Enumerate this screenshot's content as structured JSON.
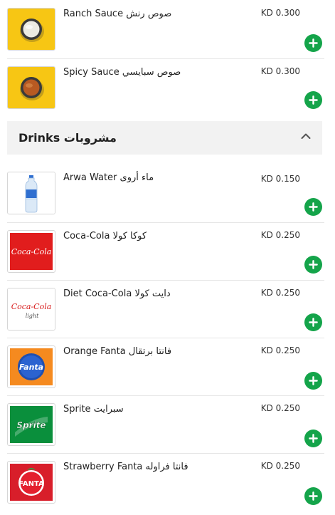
{
  "items_top": [
    {
      "name": "Ranch Sauce صوص رنش",
      "price": "KD 0.300",
      "icon": "ranch-sauce-icon"
    },
    {
      "name": "Spicy Sauce صوص سبايسي",
      "price": "KD 0.300",
      "icon": "spicy-sauce-icon"
    }
  ],
  "section": {
    "title": "Drinks مشروبات",
    "icon": "chevron-up-icon"
  },
  "drinks": [
    {
      "name": "Arwa Water ماء أروى",
      "price": "KD 0.150",
      "icon": "water-bottle-icon"
    },
    {
      "name": "Coca-Cola كوكا كولا",
      "price": "KD 0.250",
      "icon": "coca-cola-logo"
    },
    {
      "name": "Diet Coca-Cola دايت كولا",
      "price": "KD 0.250",
      "icon": "diet-coke-logo"
    },
    {
      "name": "Orange Fanta فانتا برتقال",
      "price": "KD 0.250",
      "icon": "fanta-orange-logo"
    },
    {
      "name": "Sprite سبرايت",
      "price": "KD 0.250",
      "icon": "sprite-logo"
    },
    {
      "name": "Strawberry Fanta فانتا فراوله",
      "price": "KD 0.250",
      "icon": "fanta-strawberry-logo"
    }
  ],
  "colors": {
    "add_button": "#14a44a",
    "section_bg": "#f2f2f2",
    "sauce_bg": "#f7c614"
  },
  "logo_texts": {
    "coca_cola": "Coca-Cola",
    "coke_light": "light",
    "fanta": "Fanta",
    "fanta_caps": "FANTA",
    "sprite": "Sprite"
  }
}
